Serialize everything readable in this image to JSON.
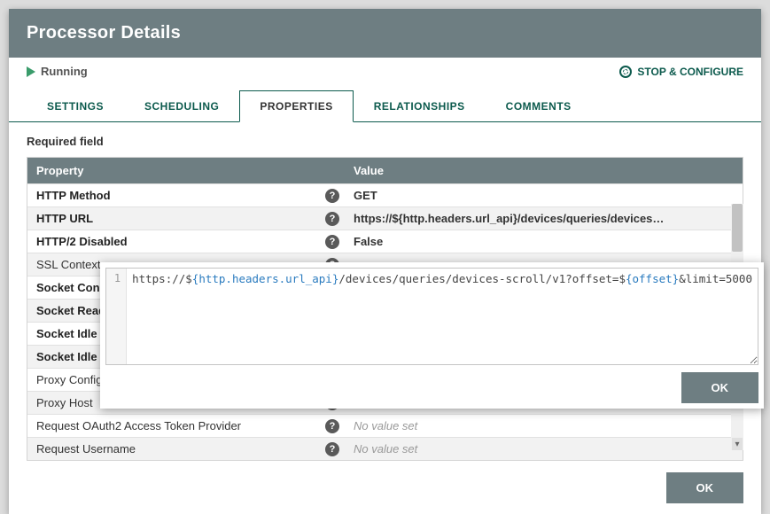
{
  "dialog": {
    "title": "Processor Details",
    "status_label": "Running",
    "stop_label": "STOP & CONFIGURE",
    "ok_label": "OK"
  },
  "tabs": [
    {
      "label": "SETTINGS"
    },
    {
      "label": "SCHEDULING"
    },
    {
      "label": "PROPERTIES"
    },
    {
      "label": "RELATIONSHIPS"
    },
    {
      "label": "COMMENTS"
    }
  ],
  "active_tab_index": 2,
  "required_field_label": "Required field",
  "columns": {
    "property": "Property",
    "value": "Value"
  },
  "info_glyph": "?",
  "no_value_text": "No value set",
  "rows": [
    {
      "name": "HTTP Method",
      "bold": true,
      "value": "GET"
    },
    {
      "name": "HTTP URL",
      "bold": true,
      "value": "https://${http.headers.url_api}/devices/queries/devices…"
    },
    {
      "name": "HTTP/2 Disabled",
      "bold": true,
      "value": "False"
    },
    {
      "name": "SSL Context",
      "bold": false,
      "value": ""
    },
    {
      "name": "Socket Conn",
      "bold": true,
      "value": ""
    },
    {
      "name": "Socket Read",
      "bold": true,
      "value": ""
    },
    {
      "name": "Socket Idle",
      "bold": true,
      "value": ""
    },
    {
      "name": "Socket Idle",
      "bold": true,
      "value": ""
    },
    {
      "name": "Proxy Config",
      "bold": false,
      "value": ""
    },
    {
      "name": "Proxy Host",
      "bold": false,
      "value": ""
    },
    {
      "name": "Request OAuth2 Access Token Provider",
      "bold": false,
      "value": "",
      "novalue": true
    },
    {
      "name": "Request Username",
      "bold": false,
      "value": "",
      "novalue": true
    }
  ],
  "popup": {
    "line_number": "1",
    "segments": [
      {
        "t": "https://$"
      },
      {
        "t": "{http.headers.url_api}",
        "cls": "tok-el"
      },
      {
        "t": "/devices/queries/devices-scroll/v1?offset=$"
      },
      {
        "t": "{offset}",
        "cls": "tok-el"
      },
      {
        "t": "&limit=5000"
      }
    ],
    "ok_label": "OK"
  }
}
